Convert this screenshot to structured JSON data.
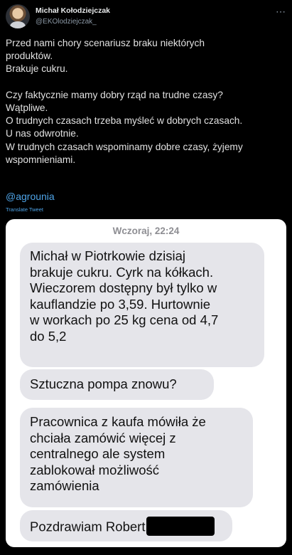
{
  "author": {
    "name": "Michał Kołodziejczak",
    "handle": "@EKOlodziejczak_",
    "more_icon": "ellipsis-icon"
  },
  "tweet": {
    "lines": [
      "Przed nami chory scenariusz braku niektórych",
      "produktów.",
      "Brakuje cukru.",
      "",
      "Czy faktycznie mamy dobry rząd na trudne czasy?",
      "Wątpliwe.",
      "O trudnych czasach trzeba myśleć w dobrych czasach.",
      "U nas odwrotnie.",
      "W trudnych czasach wspominamy dobre czasy, żyjemy",
      "wspomnieniami."
    ],
    "mention": "@agrounia",
    "translate_label": "Translate Tweet"
  },
  "message_screenshot": {
    "date_label": "Wczoraj, 22:24",
    "bubbles": [
      {
        "lines": [
          "Michał w Piotrkowie dzisiaj",
          "brakuje cukru. Cyrk na kółkach.",
          "Wieczorem dostępny był tylko w",
          "kauflandzie po 3,59. Hurtownie",
          "w workach po 25 kg cena od 4,7",
          "do 5,2"
        ]
      },
      {
        "lines": [
          "Sztuczna pompa znowu?"
        ]
      },
      {
        "lines": [
          "Pracownica z kaufa mówiła że",
          "chciała zamówić więcej z",
          "centralnego ale system",
          "zablokował możliwość",
          "zamówienia"
        ]
      },
      {
        "lines": [
          "Pozdrawiam Robert"
        ],
        "redacted": true
      }
    ]
  },
  "colors": {
    "background": "#000000",
    "link": "#4ea4e8",
    "bubble": "#e5e5ea"
  }
}
